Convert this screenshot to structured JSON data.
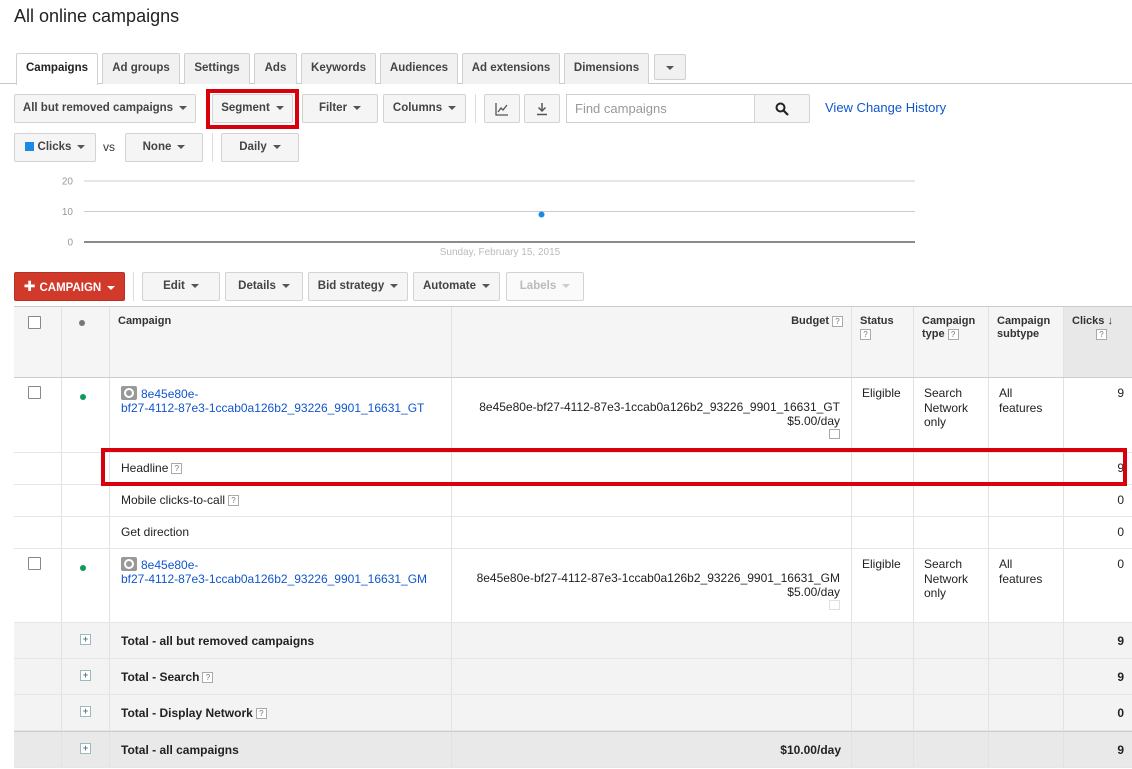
{
  "page": {
    "title": "All online campaigns"
  },
  "tabs": [
    {
      "label": "Campaigns"
    },
    {
      "label": "Ad groups"
    },
    {
      "label": "Settings"
    },
    {
      "label": "Ads"
    },
    {
      "label": "Keywords"
    },
    {
      "label": "Audiences"
    },
    {
      "label": "Ad extensions"
    },
    {
      "label": "Dimensions"
    }
  ],
  "toolbar": {
    "filter_scope": "All but removed campaigns",
    "segment": "Segment",
    "filter": "Filter",
    "columns": "Columns",
    "search_placeholder": "Find campaigns",
    "view_history": "View Change History"
  },
  "chart_controls": {
    "metric1": "Clicks",
    "vs": "vs",
    "metric2": "None",
    "period": "Daily"
  },
  "chart_data": {
    "type": "line",
    "x": [
      "Sunday, February 15, 2015"
    ],
    "series": [
      {
        "values": [
          9
        ]
      }
    ],
    "y_ticks": [
      "20",
      "10",
      "0"
    ],
    "ylim": [
      0,
      20
    ],
    "grid": true,
    "colors": {
      "series": "#1a8ae6"
    }
  },
  "actions": {
    "campaign": "CAMPAIGN",
    "edit": "Edit",
    "details": "Details",
    "bid_strategy": "Bid strategy",
    "automate": "Automate",
    "labels": "Labels"
  },
  "table": {
    "headers": {
      "campaign": "Campaign",
      "budget": "Budget",
      "status": "Status",
      "campaign_type_1": "Campaign",
      "campaign_type_2": "type",
      "campaign_subtype_1": "Campaign",
      "campaign_subtype_2": "subtype",
      "clicks": "Clicks",
      "help": "?"
    },
    "rows": [
      {
        "name_1": "8e45e80e-",
        "name_2": "bf27-4112-87e3-1ccab0a126b2_93226_9901_16631_GT",
        "budget_name": "8e45e80e-bf27-4112-87e3-1ccab0a126b2_93226_9901_16631_GT",
        "budget_amount": "$5.00/day",
        "status": "Eligible",
        "type_1": "Search",
        "type_2": "Network",
        "type_3": "only",
        "subtype_1": "All",
        "subtype_2": "features",
        "clicks": "9"
      },
      {
        "name_1": "8e45e80e-",
        "name_2": "bf27-4112-87e3-1ccab0a126b2_93226_9901_16631_GM",
        "budget_name": "8e45e80e-bf27-4112-87e3-1ccab0a126b2_93226_9901_16631_GM",
        "budget_amount": "$5.00/day",
        "status": "Eligible",
        "type_1": "Search",
        "type_2": "Network",
        "type_3": "only",
        "subtype_1": "All",
        "subtype_2": "features",
        "clicks": "0"
      }
    ],
    "segments": [
      {
        "label": "Headline",
        "clicks": "9"
      },
      {
        "label": "Mobile clicks-to-call",
        "clicks": "0"
      },
      {
        "label": "Get direction",
        "clicks": "0"
      }
    ],
    "totals": [
      {
        "label": "Total - all but removed campaigns",
        "budget": "",
        "clicks": "9"
      },
      {
        "label": "Total - Search",
        "budget": "",
        "clicks": "9"
      },
      {
        "label": "Total - Display Network",
        "budget": "",
        "clicks": "0"
      },
      {
        "label": "Total - all campaigns",
        "budget": "$10.00/day",
        "clicks": "9"
      }
    ]
  },
  "colors": {
    "highlight": "#d8000c",
    "link": "#1155cc",
    "campaign_button": "#d1392a",
    "enabled_dot": "#0a9d58"
  }
}
